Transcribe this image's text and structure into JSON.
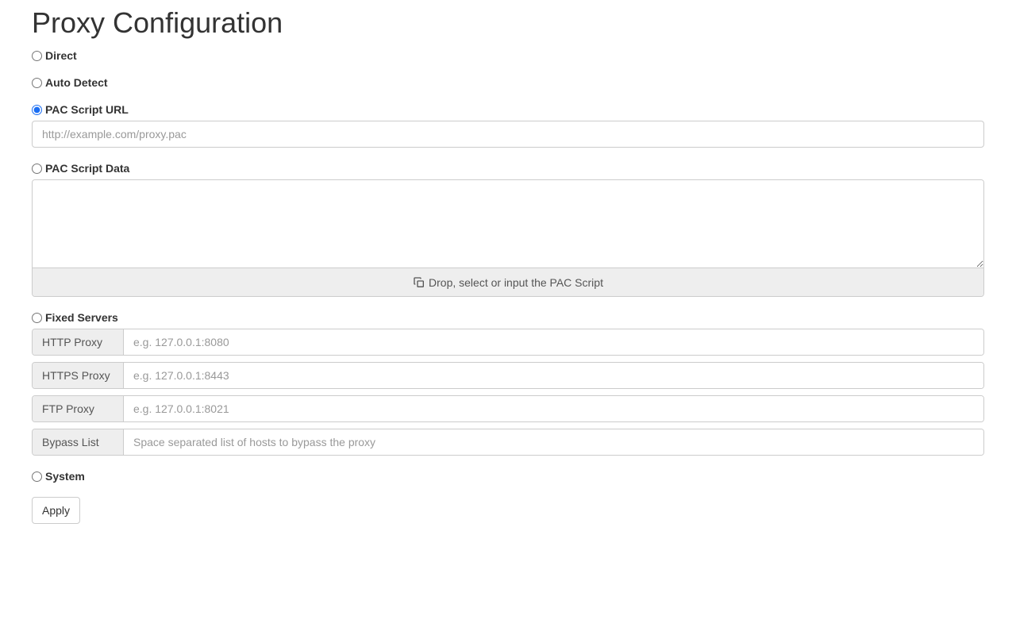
{
  "title": "Proxy Configuration",
  "options": {
    "direct": {
      "label": "Direct"
    },
    "auto_detect": {
      "label": "Auto Detect"
    },
    "pac_url": {
      "label": "PAC Script URL",
      "placeholder": "http://example.com/proxy.pac",
      "value": ""
    },
    "pac_data": {
      "label": "PAC Script Data",
      "value": "",
      "drop_hint": "Drop, select or input the PAC Script"
    },
    "fixed": {
      "label": "Fixed Servers",
      "http": {
        "addon": "HTTP Proxy",
        "placeholder": "e.g. 127.0.0.1:8080",
        "value": ""
      },
      "https": {
        "addon": "HTTPS Proxy",
        "placeholder": "e.g. 127.0.0.1:8443",
        "value": ""
      },
      "ftp": {
        "addon": "FTP Proxy",
        "placeholder": "e.g. 127.0.0.1:8021",
        "value": ""
      },
      "bypass": {
        "addon": "Bypass List",
        "placeholder": "Space separated list of hosts to bypass the proxy",
        "value": ""
      }
    },
    "system": {
      "label": "System"
    }
  },
  "selected": "pac_url",
  "apply_label": "Apply"
}
